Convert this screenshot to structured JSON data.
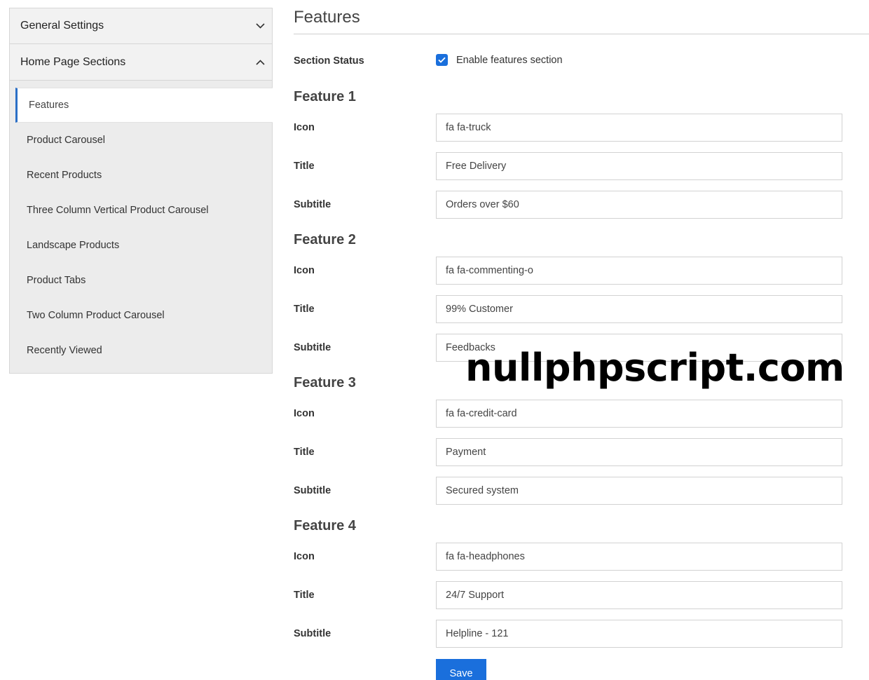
{
  "sidebar": {
    "general_settings": "General Settings",
    "home_page_sections": "Home Page Sections",
    "items": [
      {
        "label": "Features",
        "active": true
      },
      {
        "label": "Product Carousel"
      },
      {
        "label": "Recent Products"
      },
      {
        "label": "Three Column Vertical Product Carousel"
      },
      {
        "label": "Landscape Products"
      },
      {
        "label": "Product Tabs"
      },
      {
        "label": "Two Column Product Carousel"
      },
      {
        "label": "Recently Viewed"
      }
    ]
  },
  "main": {
    "title": "Features",
    "section_status_label": "Section Status",
    "enable_label": "Enable features section",
    "enabled": true,
    "labels": {
      "icon": "Icon",
      "title": "Title",
      "subtitle": "Subtitle"
    },
    "features": [
      {
        "heading": "Feature 1",
        "icon": "fa fa-truck",
        "title": "Free Delivery",
        "subtitle": "Orders over $60"
      },
      {
        "heading": "Feature 2",
        "icon": "fa fa-commenting-o",
        "title": "99% Customer",
        "subtitle": "Feedbacks"
      },
      {
        "heading": "Feature 3",
        "icon": "fa fa-credit-card",
        "title": "Payment",
        "subtitle": "Secured system"
      },
      {
        "heading": "Feature 4",
        "icon": "fa fa-headphones",
        "title": "24/7 Support",
        "subtitle": "Helpline - 121"
      }
    ],
    "save_label": "Save"
  },
  "watermark": "nullphpscript.com",
  "colors": {
    "accent": "#1a6fdc",
    "active_border": "#2b6fc6"
  }
}
